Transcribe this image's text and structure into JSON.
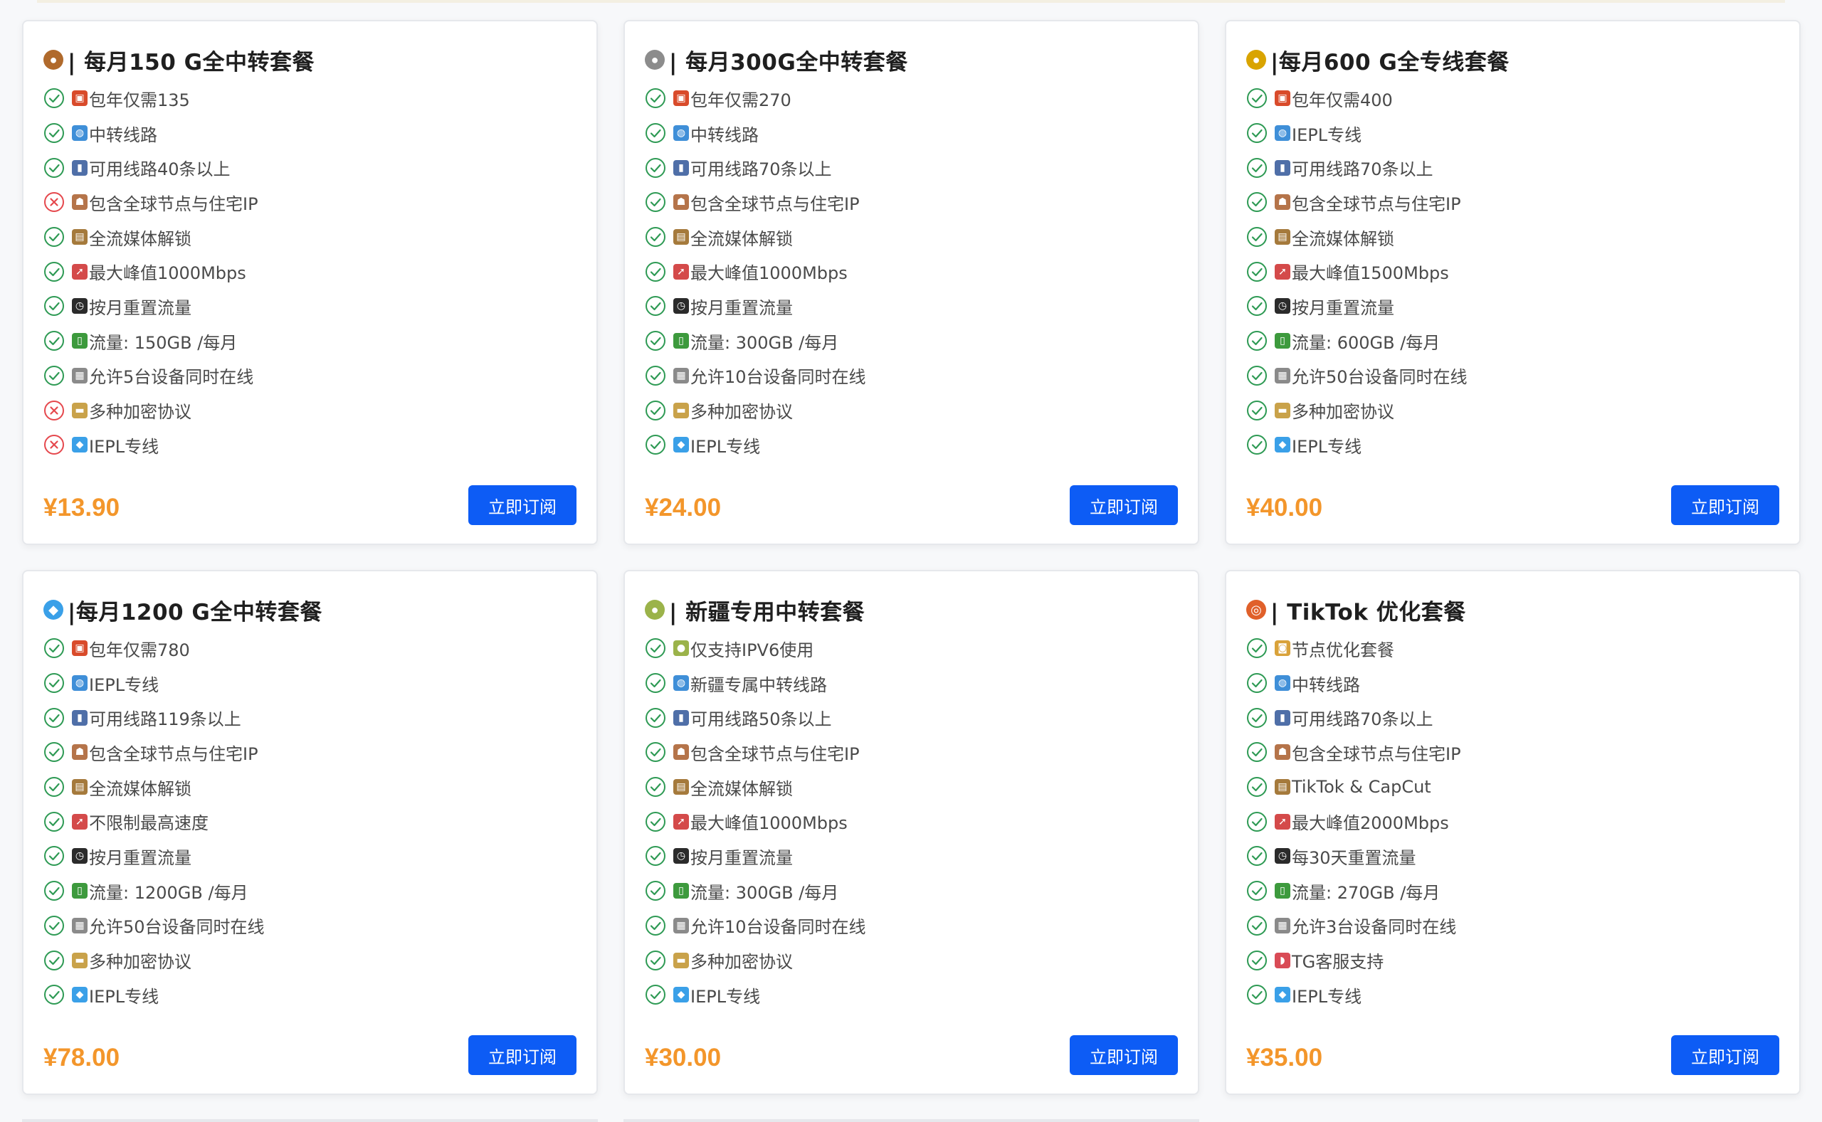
{
  "colors": {
    "accent_button": "#0d5cf5",
    "price": "#f3962b",
    "check": "#2e9a54",
    "cross": "#e5484d"
  },
  "cards": [
    {
      "emoji": "bronze-medal-icon",
      "title": "| 每月150 G全中转套餐",
      "price": "¥13.90",
      "button": "立即订阅",
      "features": [
        {
          "ok": true,
          "icon": "gift-icon",
          "text": "包年仅需135"
        },
        {
          "ok": true,
          "icon": "globe-icon",
          "text": "中转线路"
        },
        {
          "ok": true,
          "icon": "signal-icon",
          "text": "可用线路40条以上"
        },
        {
          "ok": false,
          "icon": "family-icon",
          "text": "包含全球节点与住宅IP"
        },
        {
          "ok": true,
          "icon": "media-icon",
          "text": "全流媒体解锁"
        },
        {
          "ok": true,
          "icon": "rocket-icon",
          "text": "最大峰值1000Mbps"
        },
        {
          "ok": true,
          "icon": "watch-icon",
          "text": "按月重置流量"
        },
        {
          "ok": true,
          "icon": "battery-icon",
          "text": "流量: 150GB /每月"
        },
        {
          "ok": true,
          "icon": "device-icon",
          "text": "允许5台设备同时在线"
        },
        {
          "ok": false,
          "icon": "card-icon",
          "text": "多种加密协议"
        },
        {
          "ok": false,
          "icon": "diamond-icon",
          "text": "IEPL专线"
        }
      ]
    },
    {
      "emoji": "silver-medal-icon",
      "title": "| 每月300G全中转套餐",
      "price": "¥24.00",
      "button": "立即订阅",
      "features": [
        {
          "ok": true,
          "icon": "gift-icon",
          "text": "包年仅需270"
        },
        {
          "ok": true,
          "icon": "globe-icon",
          "text": "中转线路"
        },
        {
          "ok": true,
          "icon": "signal-icon",
          "text": "可用线路70条以上"
        },
        {
          "ok": true,
          "icon": "family-icon",
          "text": "包含全球节点与住宅IP"
        },
        {
          "ok": true,
          "icon": "media-icon",
          "text": "全流媒体解锁"
        },
        {
          "ok": true,
          "icon": "rocket-icon",
          "text": "最大峰值1000Mbps"
        },
        {
          "ok": true,
          "icon": "watch-icon",
          "text": "按月重置流量"
        },
        {
          "ok": true,
          "icon": "battery-icon",
          "text": "流量: 300GB /每月"
        },
        {
          "ok": true,
          "icon": "device-icon",
          "text": "允许10台设备同时在线"
        },
        {
          "ok": true,
          "icon": "card-icon",
          "text": "多种加密协议"
        },
        {
          "ok": true,
          "icon": "diamond-icon",
          "text": "IEPL专线"
        }
      ]
    },
    {
      "emoji": "gold-medal-icon",
      "title": "|每月600 G全专线套餐",
      "price": "¥40.00",
      "button": "立即订阅",
      "features": [
        {
          "ok": true,
          "icon": "gift-icon",
          "text": "包年仅需400"
        },
        {
          "ok": true,
          "icon": "globe-icon",
          "text": "IEPL专线"
        },
        {
          "ok": true,
          "icon": "signal-icon",
          "text": "可用线路70条以上"
        },
        {
          "ok": true,
          "icon": "family-icon",
          "text": "包含全球节点与住宅IP"
        },
        {
          "ok": true,
          "icon": "media-icon",
          "text": "全流媒体解锁"
        },
        {
          "ok": true,
          "icon": "rocket-icon",
          "text": "最大峰值1500Mbps"
        },
        {
          "ok": true,
          "icon": "watch-icon",
          "text": "按月重置流量"
        },
        {
          "ok": true,
          "icon": "battery-icon",
          "text": "流量: 600GB /每月"
        },
        {
          "ok": true,
          "icon": "device-icon",
          "text": "允许50台设备同时在线"
        },
        {
          "ok": true,
          "icon": "card-icon",
          "text": "多种加密协议"
        },
        {
          "ok": true,
          "icon": "diamond-icon",
          "text": "IEPL专线"
        }
      ]
    },
    {
      "emoji": "diamond-icon",
      "title": "|每月1200 G全中转套餐",
      "price": "¥78.00",
      "button": "立即订阅",
      "features": [
        {
          "ok": true,
          "icon": "gift-icon",
          "text": "包年仅需780"
        },
        {
          "ok": true,
          "icon": "globe-icon",
          "text": "IEPL专线"
        },
        {
          "ok": true,
          "icon": "signal-icon",
          "text": "可用线路119条以上"
        },
        {
          "ok": true,
          "icon": "family-icon",
          "text": "包含全球节点与住宅IP"
        },
        {
          "ok": true,
          "icon": "media-icon",
          "text": "全流媒体解锁"
        },
        {
          "ok": true,
          "icon": "rocket-icon",
          "text": "不限制最高速度"
        },
        {
          "ok": true,
          "icon": "watch-icon",
          "text": "按月重置流量"
        },
        {
          "ok": true,
          "icon": "battery-icon",
          "text": "流量: 1200GB /每月"
        },
        {
          "ok": true,
          "icon": "device-icon",
          "text": "允许50台设备同时在线"
        },
        {
          "ok": true,
          "icon": "card-icon",
          "text": "多种加密协议"
        },
        {
          "ok": true,
          "icon": "diamond-icon",
          "text": "IEPL专线"
        }
      ]
    },
    {
      "emoji": "melon-icon",
      "title": "| 新疆专用中转套餐",
      "price": "¥30.00",
      "button": "立即订阅",
      "features": [
        {
          "ok": true,
          "icon": "melon-icon",
          "text": "仅支持IPV6使用"
        },
        {
          "ok": true,
          "icon": "globe-icon",
          "text": "新疆专属中转线路"
        },
        {
          "ok": true,
          "icon": "signal-icon",
          "text": "可用线路50条以上"
        },
        {
          "ok": true,
          "icon": "family-icon",
          "text": "包含全球节点与住宅IP"
        },
        {
          "ok": true,
          "icon": "media-icon",
          "text": "全流媒体解锁"
        },
        {
          "ok": true,
          "icon": "rocket-icon",
          "text": "最大峰值1000Mbps"
        },
        {
          "ok": true,
          "icon": "watch-icon",
          "text": "按月重置流量"
        },
        {
          "ok": true,
          "icon": "battery-icon",
          "text": "流量: 300GB /每月"
        },
        {
          "ok": true,
          "icon": "device-icon",
          "text": "允许10台设备同时在线"
        },
        {
          "ok": true,
          "icon": "card-icon",
          "text": "多种加密协议"
        },
        {
          "ok": true,
          "icon": "diamond-icon",
          "text": "IEPL专线"
        }
      ]
    },
    {
      "emoji": "lollipop-icon",
      "title": "| TikTok 优化套餐",
      "price": "¥35.00",
      "button": "立即订阅",
      "features": [
        {
          "ok": true,
          "icon": "beer-icon",
          "text": "节点优化套餐"
        },
        {
          "ok": true,
          "icon": "globe-icon",
          "text": "中转线路"
        },
        {
          "ok": true,
          "icon": "signal-icon",
          "text": "可用线路70条以上"
        },
        {
          "ok": true,
          "icon": "family-icon",
          "text": "包含全球节点与住宅IP"
        },
        {
          "ok": true,
          "icon": "media-icon",
          "text": "TikTok & CapCut"
        },
        {
          "ok": true,
          "icon": "rocket-icon",
          "text": "最大峰值2000Mbps"
        },
        {
          "ok": true,
          "icon": "watch-icon",
          "text": "每30天重置流量"
        },
        {
          "ok": true,
          "icon": "battery-icon",
          "text": "流量: 270GB /每月"
        },
        {
          "ok": true,
          "icon": "device-icon",
          "text": "允许3台设备同时在线"
        },
        {
          "ok": true,
          "icon": "watermelon-icon",
          "text": "TG客服支持"
        },
        {
          "ok": true,
          "icon": "diamond-icon",
          "text": "IEPL专线"
        }
      ]
    }
  ]
}
